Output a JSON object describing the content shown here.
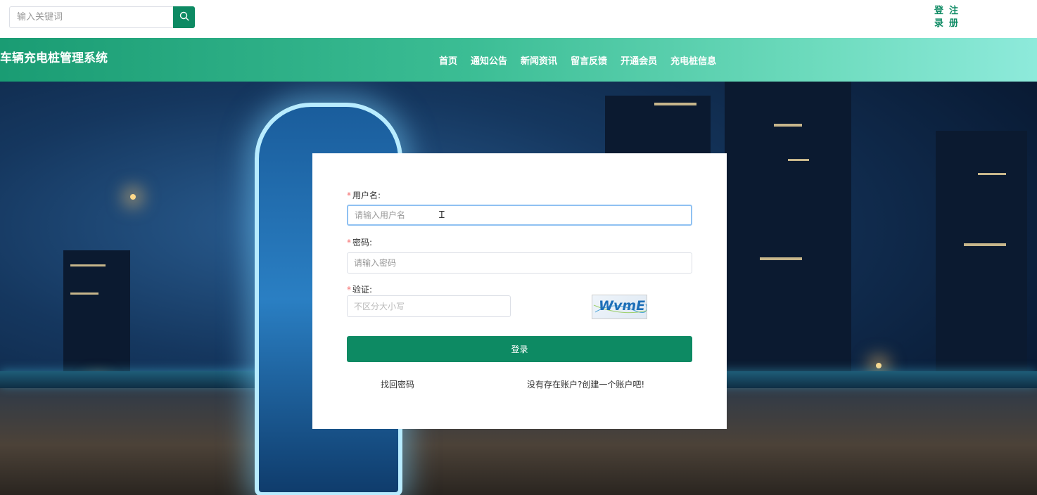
{
  "header": {
    "search_placeholder": "输入关键词",
    "login_label": "登录",
    "register_label": "注册"
  },
  "nav": {
    "site_title": "车辆充电桩管理系统",
    "items": [
      "首页",
      "通知公告",
      "新闻资讯",
      "留言反馈",
      "开通会员",
      "充电桩信息"
    ]
  },
  "login_form": {
    "username_label": "用户名:",
    "username_placeholder": "请输入用户名",
    "password_label": "密码:",
    "password_placeholder": "请输入密码",
    "captcha_label": "验证:",
    "captcha_placeholder": "不区分大小写",
    "captcha_text": "WvmE",
    "required_mark": "*",
    "submit_label": "登录",
    "forgot_password": "找回密码",
    "register_prompt": "没有存在账户?创建一个账户吧!"
  },
  "colors": {
    "brand": "#0d8a63",
    "required": "#f56c6c",
    "focus_border": "#8fc1f2"
  },
  "icons": {
    "search": "search-icon"
  }
}
